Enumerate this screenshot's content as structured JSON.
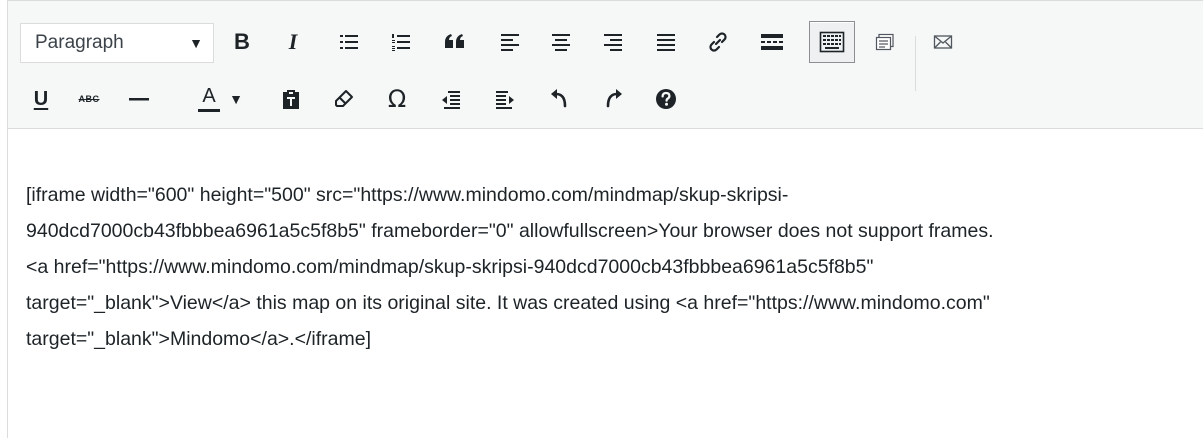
{
  "toolbar": {
    "format_select": {
      "selected": "Paragraph"
    },
    "row1": [
      "bold-icon",
      "italic-icon",
      "bullet-list-icon",
      "numbered-list-icon",
      "blockquote-icon",
      "align-left-icon",
      "align-center-icon",
      "align-right-icon",
      "align-justify-icon",
      "link-icon",
      "read-more-icon",
      "toolbar-toggle-icon",
      "media-icon",
      "mail-icon"
    ],
    "row2": [
      "underline-icon",
      "strikethrough-icon",
      "horizontal-line-icon",
      "text-color-icon",
      "paste-as-text-icon",
      "clear-formatting-icon",
      "special-character-icon",
      "outdent-icon",
      "indent-icon",
      "undo-icon",
      "redo-icon",
      "help-icon"
    ],
    "labels": {
      "bold": "B",
      "italic": "I",
      "underline": "U",
      "strikethrough": "ABC",
      "text_color": "A",
      "omega": "Ω",
      "caret": "▼"
    }
  },
  "content": {
    "text": "[iframe width=\"600\" height=\"500\" src=\"https://www.mindomo.com/mindmap/skup-skripsi-940dcd7000cb43fbbbea6961a5c5f8b5\" frameborder=\"0\" allowfullscreen>Your browser does not support frames. <a href=\"https://www.mindomo.com/mindmap/skup-skripsi-940dcd7000cb43fbbbea6961a5c5f8b5\" target=\"_blank\">View</a> this map on its original site. It was created using <a href=\"https://www.mindomo.com\" target=\"_blank\">Mindomo</a>.</iframe]"
  }
}
